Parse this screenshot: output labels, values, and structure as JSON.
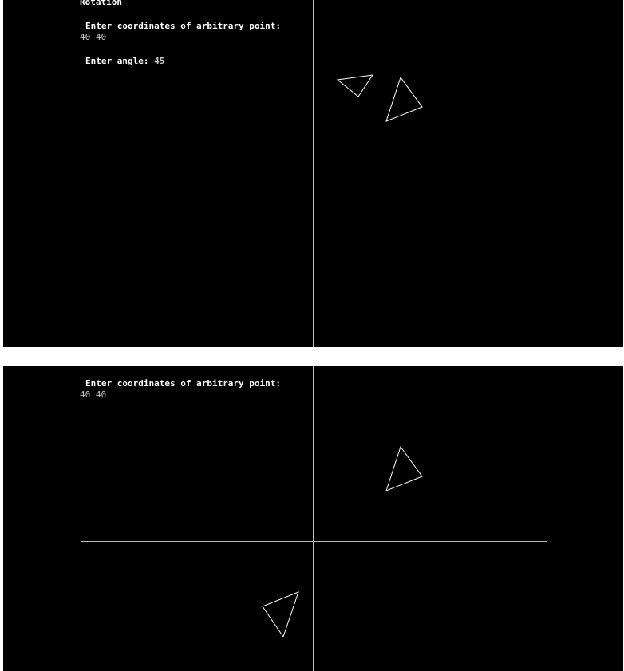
{
  "colors": {
    "background": "#000000",
    "axis": "#d4c83a",
    "shape": "#ffffff",
    "prompt_text": "#ffffff",
    "input_text": "#c8c8c8"
  },
  "top_screen": {
    "title": "Rotation",
    "point_prompt": "Enter coordinates of arbitrary point:",
    "point_input": "40 40",
    "angle_prompt": "Enter angle:",
    "angle_input": "45"
  },
  "bottom_screen": {
    "point_prompt": "Enter coordinates of arbitrary point:",
    "point_input": "40 40"
  }
}
